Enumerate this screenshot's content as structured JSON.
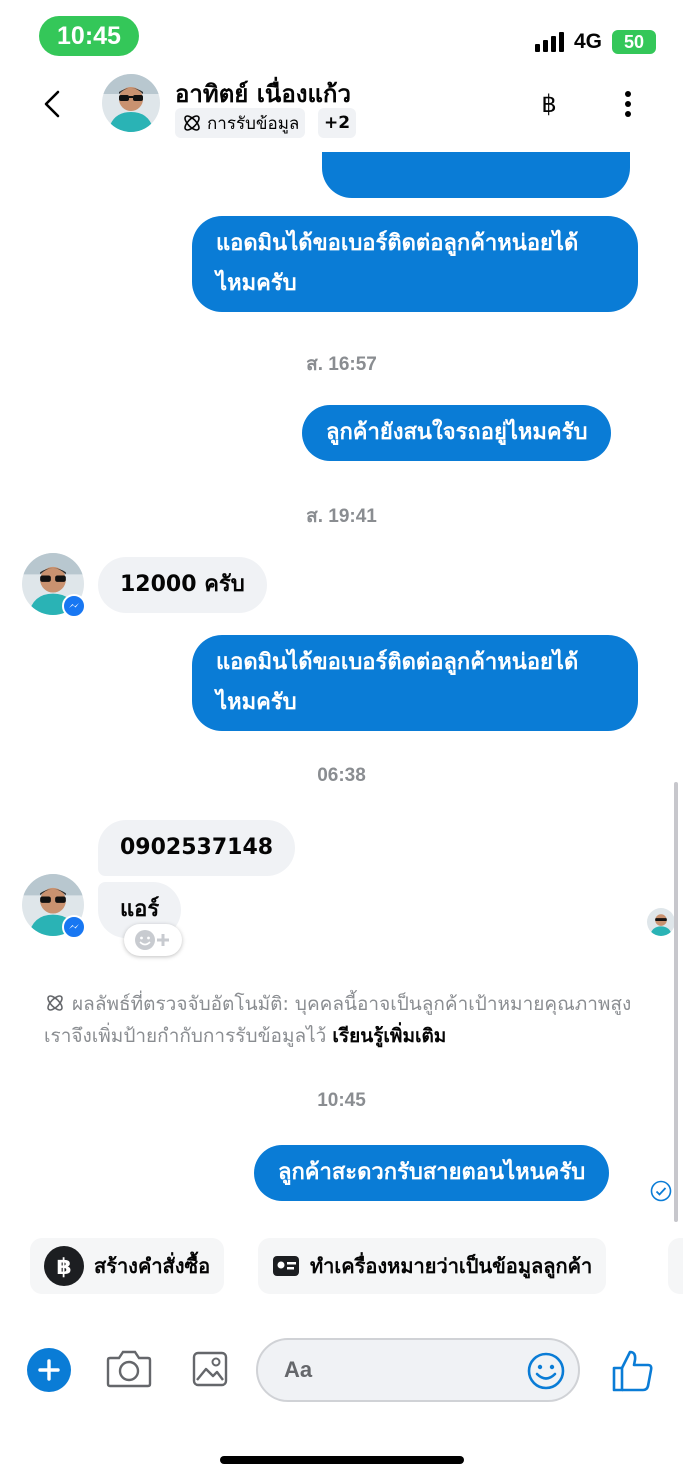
{
  "status_bar": {
    "time": "10:45",
    "network": "4G",
    "battery": "50"
  },
  "header": {
    "contact_name": "อาทิตย์ เนื่องแก้ว",
    "tag_label": "การรับข้อมูล",
    "more_tags": "+2",
    "currency_symbol": "฿"
  },
  "messages": {
    "out_1": "แอดมินได้ขอเบอร์ติดต่อลูกค้าหน่อยได้ไหมครับ",
    "ts_1": "ส. 16:57",
    "out_2": "ลูกค้ายังสนใจรถอยู่ไหมครับ",
    "ts_2": "ส. 19:41",
    "in_1": "12000 ครับ",
    "out_3": "แอดมินได้ขอเบอร์ติดต่อลูกค้าหน่อยได้ไหมครับ",
    "ts_3": "06:38",
    "in_2": "0902537148",
    "in_3": "แอร์",
    "notice_text": "ผลลัพธ์ที่ตรวจจับอัตโนมัติ: บุคคลนี้อาจเป็นลูกค้าเป้าหมายคุณภาพสูง เราจึงเพิ่มป้ายกำกับการรับข้อมูลไว้",
    "notice_link": "เรียนรู้เพิ่มเติม",
    "ts_4": "10:45",
    "out_4": "ลูกค้าสะดวกรับสายตอนไหนครับ"
  },
  "quick_actions": {
    "create_order": "สร้างคำสั่งซื้อ",
    "mark_lead": "ทำเครื่องหมายว่าเป็นข้อมูลลูกค้า"
  },
  "composer": {
    "placeholder": "Aa"
  },
  "colors": {
    "accent": "#0a7cd6",
    "incoming_bubble": "#f0f2f5",
    "status_green": "#34c759"
  },
  "icons": [
    "back-icon",
    "atom-icon",
    "baht-icon",
    "more-vert-icon",
    "messenger-badge-icon",
    "add-reaction-icon",
    "check-circle-icon",
    "baht-circle-icon",
    "id-card-icon",
    "plus-icon",
    "camera-icon",
    "image-icon",
    "emoji-icon",
    "thumbs-up-icon"
  ]
}
